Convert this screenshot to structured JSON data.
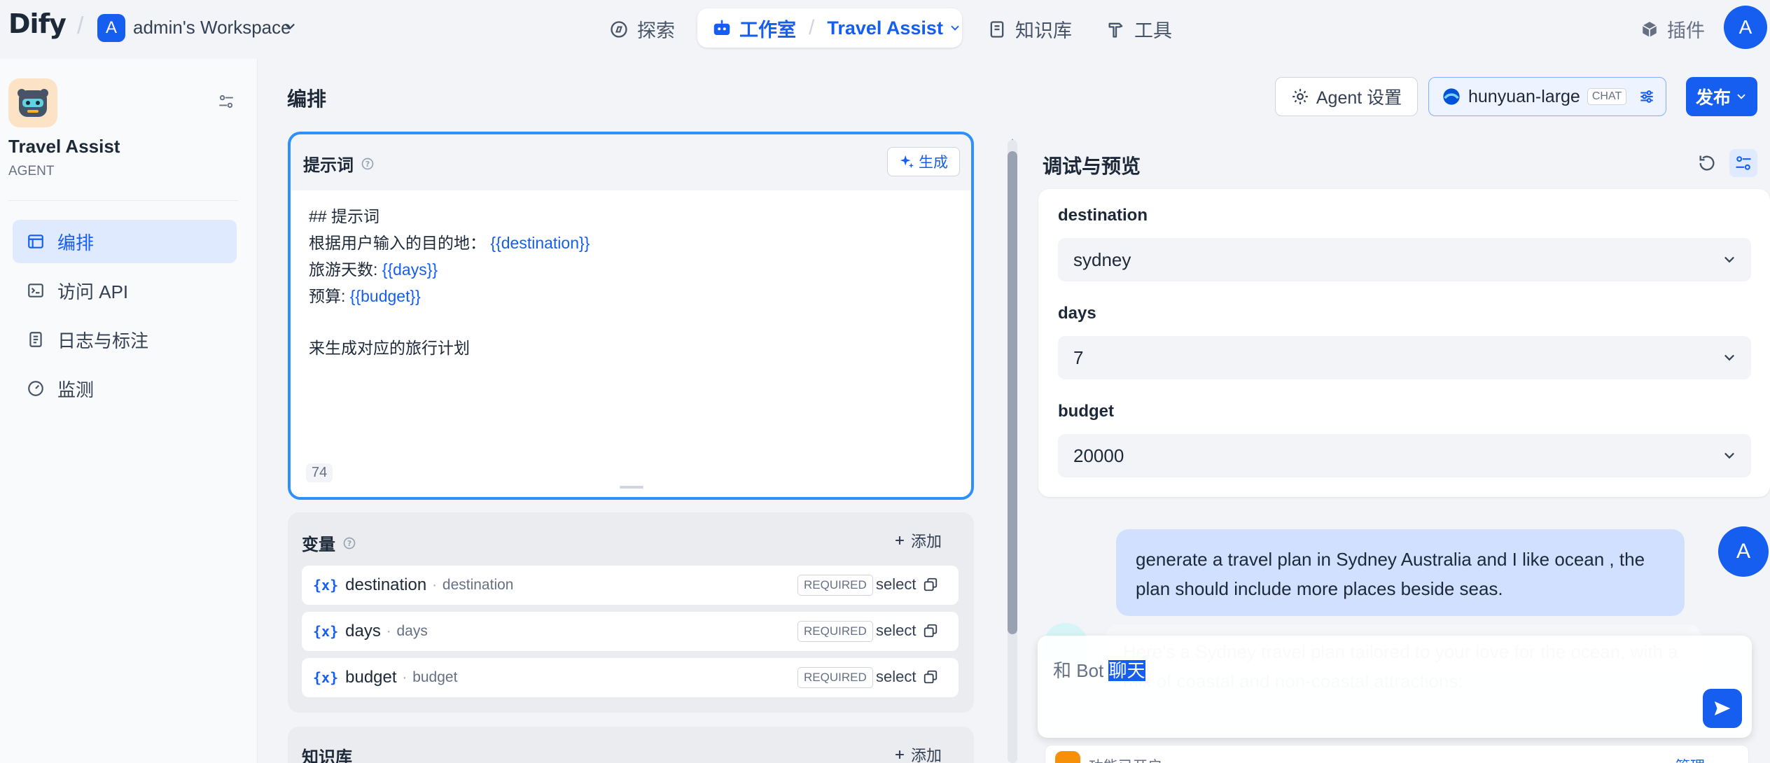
{
  "topbar": {
    "logo_text": "Dify",
    "workspace_badge": "A",
    "workspace_name": "admin's Workspace",
    "nav": {
      "explore": "探索",
      "studio": "工作室",
      "current_app": "Travel Assist",
      "knowledge": "知识库",
      "tools": "工具"
    },
    "plugins": "插件",
    "user_initial": "A"
  },
  "sidebar": {
    "app_name": "Travel Assist",
    "app_type": "AGENT",
    "items": [
      {
        "label": "编排",
        "icon": "layout-icon",
        "active": true
      },
      {
        "label": "访问 API",
        "icon": "terminal-icon",
        "active": false
      },
      {
        "label": "日志与标注",
        "icon": "file-list-icon",
        "active": false
      },
      {
        "label": "监测",
        "icon": "dashboard-icon",
        "active": false
      }
    ]
  },
  "header": {
    "title": "编排",
    "agent_settings": "Agent 设置",
    "model_name": "hunyuan-large",
    "model_mode": "CHAT",
    "publish": "发布"
  },
  "prompt": {
    "title": "提示词",
    "generate": "生成",
    "line1": "## 提示词",
    "line2_text": "根据用户输入的目的地：",
    "line2_var": "{{destination}}",
    "line3_text": "旅游天数:",
    "line3_var": "{{days}}",
    "line4_text": "预算:",
    "line4_var": "{{budget}}",
    "line5": "来生成对应的旅行计划",
    "char_count": "74"
  },
  "variables": {
    "title": "变量",
    "add": "添加",
    "required": "REQUIRED",
    "select": "select",
    "icon_text": "{x}",
    "items": [
      {
        "key": "destination",
        "label": "destination"
      },
      {
        "key": "days",
        "label": "days"
      },
      {
        "key": "budget",
        "label": "budget"
      }
    ]
  },
  "knowledge": {
    "title": "知识库",
    "add": "添加"
  },
  "debug": {
    "title": "调试与预览",
    "inputs": [
      {
        "label": "destination",
        "value": "sydney"
      },
      {
        "label": "days",
        "value": "7"
      },
      {
        "label": "budget",
        "value": "20000"
      }
    ],
    "user_message": "generate a travel plan in Sydney Australia and I like ocean , the plan should include more places beside seas.",
    "user_initial": "A",
    "bot_message": "Here's a Sydney travel plan tailored to your love for the ocean, with a mix of coastal and non-coastal attractions:",
    "input_placeholder_prefix": "和 Bot ",
    "input_placeholder_highlight": "聊天",
    "feature_text": "功能已开启",
    "feature_manage": "管理 ›"
  },
  "colors": {
    "primary": "#155eef",
    "active_bg": "#e0eaff",
    "prompt_border": "#2e90fa"
  }
}
